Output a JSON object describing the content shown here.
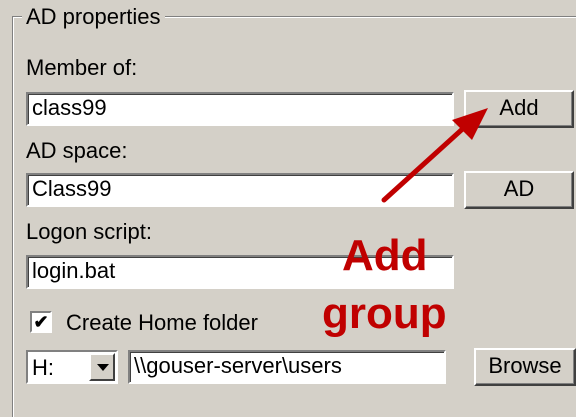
{
  "group": {
    "title": "AD properties"
  },
  "member_of": {
    "label": "Member of:",
    "value": "class99",
    "button": "Add"
  },
  "ad_space": {
    "label": "AD space:",
    "value": "Class99",
    "button": "AD"
  },
  "logon_script": {
    "label": "Logon script:",
    "value": "login.bat"
  },
  "home_folder": {
    "checkbox_label": "Create Home folder",
    "checked": true,
    "drive": "H:",
    "path": "\\\\gouser-server\\users",
    "browse_button": "Browse"
  },
  "annotation": {
    "line1": "Add",
    "line2": "group",
    "color": "#c00000",
    "icon": "red-arrow-icon"
  }
}
